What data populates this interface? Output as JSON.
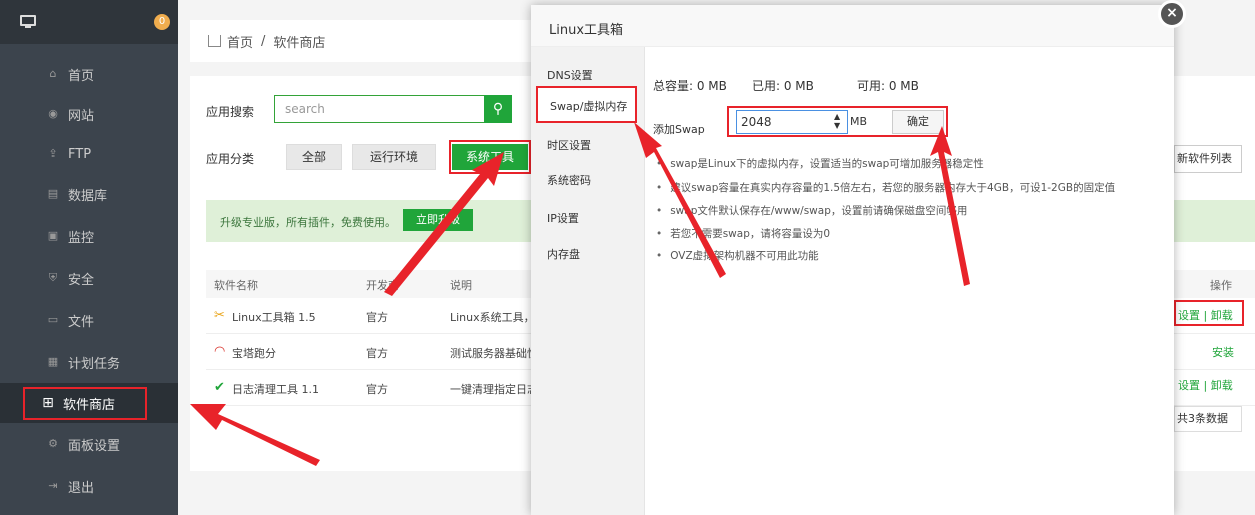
{
  "sidebar": {
    "badge": "0",
    "items": [
      {
        "label": "首页",
        "icon": "home-icon"
      },
      {
        "label": "网站",
        "icon": "globe-icon"
      },
      {
        "label": "FTP",
        "icon": "ftp-icon"
      },
      {
        "label": "数据库",
        "icon": "database-icon"
      },
      {
        "label": "监控",
        "icon": "monitor-icon"
      },
      {
        "label": "安全",
        "icon": "shield-icon"
      },
      {
        "label": "文件",
        "icon": "folder-icon"
      },
      {
        "label": "计划任务",
        "icon": "calendar-icon"
      },
      {
        "label": "软件商店",
        "icon": "grid-icon"
      },
      {
        "label": "面板设置",
        "icon": "gear-icon"
      },
      {
        "label": "退出",
        "icon": "exit-icon"
      }
    ]
  },
  "breadcrumb": {
    "home": "首页",
    "sep": "/",
    "current": "软件商店"
  },
  "store": {
    "search_label": "应用搜索",
    "search_placeholder": "search",
    "category_label": "应用分类",
    "categories": [
      "全部",
      "运行环境",
      "系统工具"
    ],
    "promo_text": "升级专业版，所有插件，免费使用。",
    "promo_button": "立即升级",
    "columns": [
      "软件名称",
      "开发商",
      "说明"
    ],
    "action_col": "操作",
    "rows": [
      {
        "name": "Linux工具箱 1.5",
        "dev": "官方",
        "desc": "Linux系统工具，",
        "action": "设置 | 卸载"
      },
      {
        "name": "宝塔跑分",
        "dev": "官方",
        "desc": "测试服务器基础性",
        "action": "安装"
      },
      {
        "name": "日志清理工具 1.1",
        "dev": "官方",
        "desc": "一键清理指定日志",
        "action": "设置 | 卸载"
      }
    ],
    "refresh": "新软件列表",
    "total": "共3条数据"
  },
  "modal": {
    "title": "Linux工具箱",
    "close": "×",
    "nav": [
      "DNS设置",
      "Swap/虚拟内存",
      "时区设置",
      "系统密码",
      "IP设置",
      "内存盘"
    ],
    "total_label": "总容量: 0 MB",
    "used_label": "已用: 0 MB",
    "free_label": "可用: 0 MB",
    "swap_label": "添加Swap",
    "swap_value": "2048",
    "swap_unit": "MB",
    "confirm": "确定",
    "tips": [
      "swap是Linux下的虚拟内存，设置适当的swap可增加服务器稳定性",
      "建议swap容量在真实内存容量的1.5倍左右，若您的服务器内存大于4GB，可设1-2GB的固定值",
      "swap文件默认保存在/www/swap，设置前请确保磁盘空间够用",
      "若您不需要swap，请将容量设为0",
      "OVZ虚拟架构机器不可用此功能"
    ]
  },
  "colors": {
    "accent": "#20a53a",
    "annotation": "#e8232a",
    "sidebar": "#3c444d"
  }
}
